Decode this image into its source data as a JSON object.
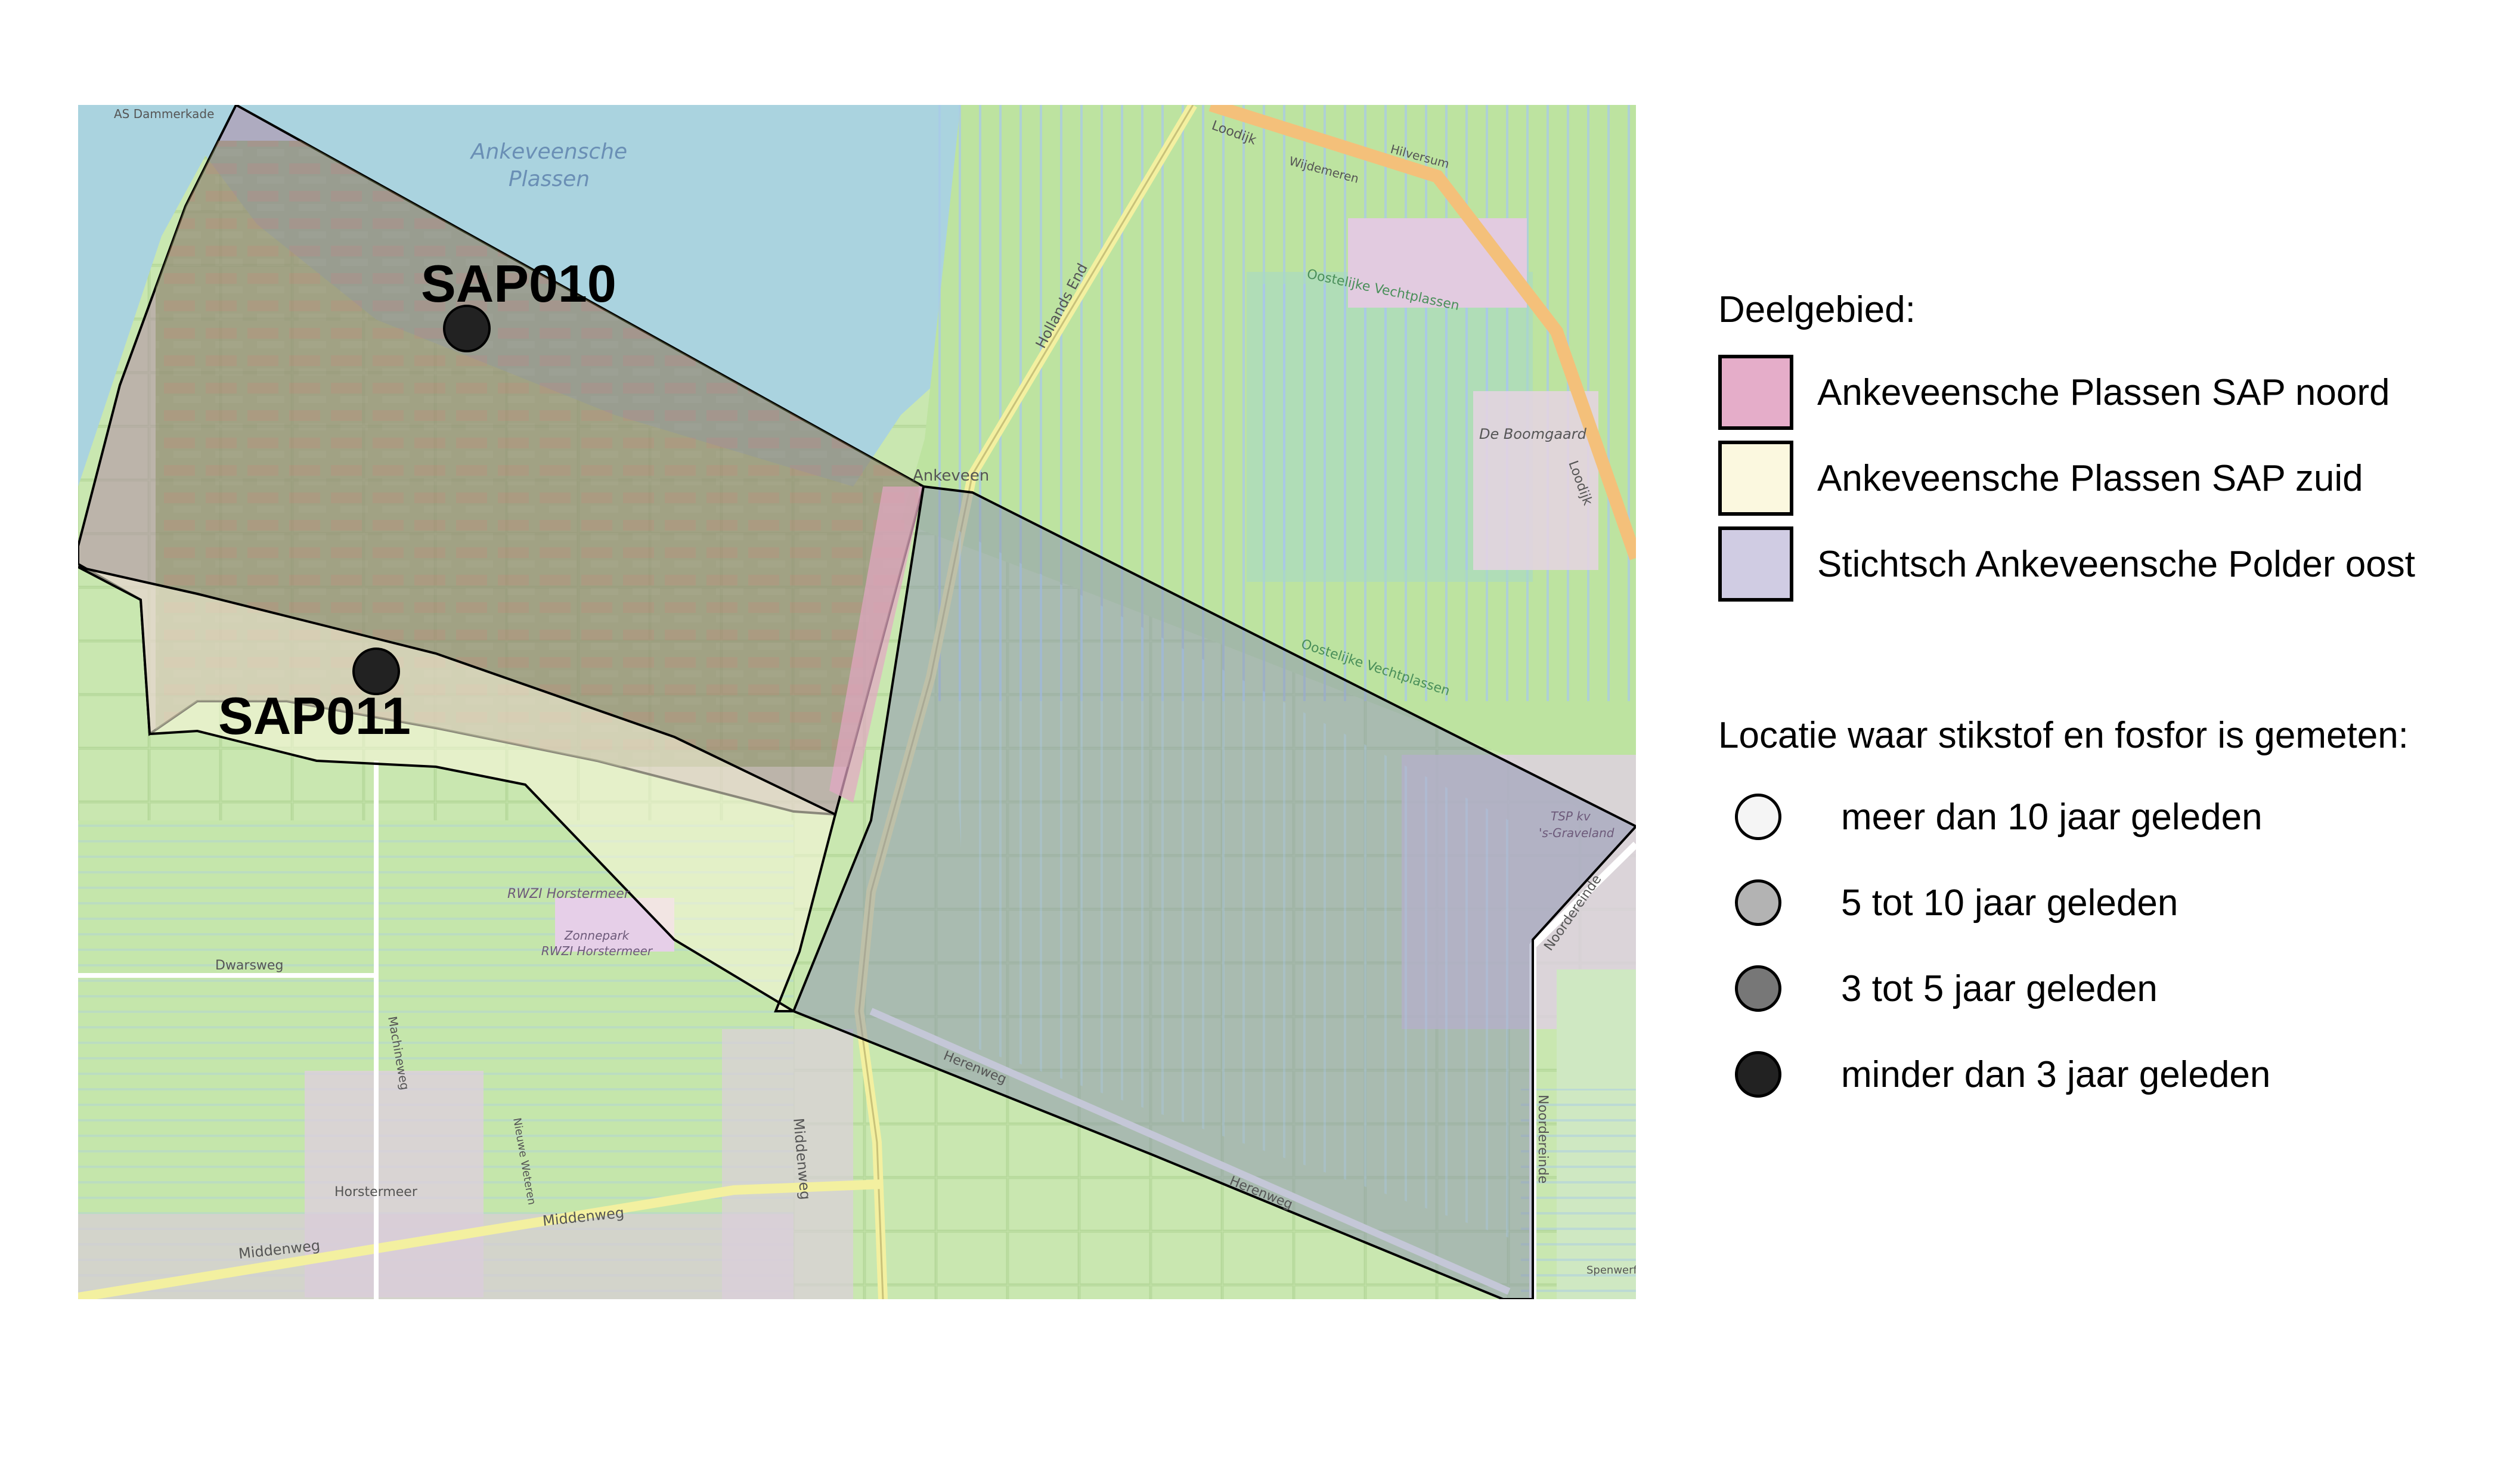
{
  "map": {
    "places": {
      "lake": [
        "Ankeveensche",
        "Plassen"
      ],
      "sap010": "SAP010",
      "sap011": "SAP011",
      "ankeveen": "Ankeveen",
      "hollands_end": "Hollands End",
      "loodijk_top": "Loodijk",
      "loodijk_right": "Loodijk",
      "oostelijke_top": "Oostelijke Vechtplassen",
      "oostelijke_mid": "Oostelijke Vechtplassen",
      "boomgaard": "De Boomgaard",
      "rwzi": "RWZI Horstermeer",
      "zonnepark": [
        "Zonnepark",
        "RWZI Horstermeer"
      ],
      "dwarsweg": "Dwarsweg",
      "middenweg_bottom": "Middenweg",
      "middenweg_center": "Middenweg",
      "middenweg_vertical": "Middenweg",
      "horstermeer": "Horstermeer",
      "herenweg_a": "Herenweg",
      "herenweg_b": "Herenweg",
      "noordereinde_top": "Noordereinde",
      "noordereinde_bottom": "Noordereinde",
      "graveland": [
        "TSP kv",
        "'s-Graveland"
      ],
      "as_dammerkade": "AS Dammerkade",
      "hilversum": "Hilversum",
      "wijdemeren": "Wijdemeren",
      "machineweg": "Machineweg",
      "nieuwe_weteren": "Nieuwe Weteren",
      "speeweg": "Spenwerf"
    }
  },
  "legend": {
    "title": "Deelgebied:",
    "areas": [
      {
        "label": "Ankeveensche Plassen SAP noord",
        "color": "#e5adc9"
      },
      {
        "label": "Ankeveensche Plassen SAP zuid",
        "color": "#fbf8df"
      },
      {
        "label": "Stichtsch Ankeveensche Polder oost",
        "color": "#d0cce3"
      }
    ],
    "locations_title": "Locatie waar stikstof en fosfor is gemeten:",
    "locations": [
      {
        "label": "meer dan 10 jaar geleden",
        "color": "#f5f5f5"
      },
      {
        "label": "5 tot 10 jaar geleden",
        "color": "#b3b3b3"
      },
      {
        "label": "3 tot 5 jaar geleden",
        "color": "#777777"
      },
      {
        "label": "minder dan 3 jaar geleden",
        "color": "#222222"
      }
    ]
  }
}
